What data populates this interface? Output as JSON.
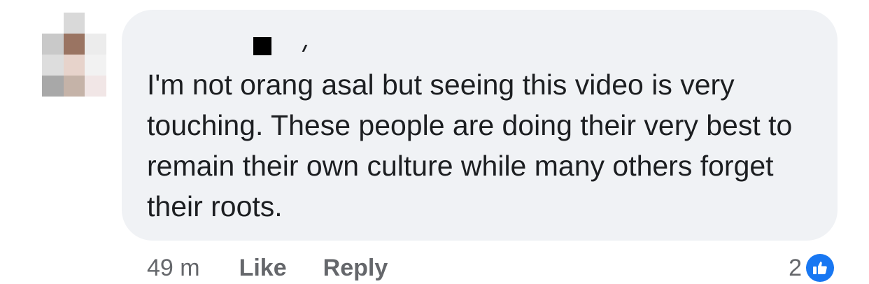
{
  "comment": {
    "text": "I'm not orang asal but seeing this video is very touching. These people are doing their very best to remain their own culture while many others forget their roots.",
    "timestamp": "49 m",
    "like_label": "Like",
    "reply_label": "Reply",
    "reaction_count": "2"
  },
  "icons": {
    "reaction": "thumbs-up-icon",
    "avatar": "profile-avatar-pixelated"
  },
  "colors": {
    "bubble_background": "#f0f2f5",
    "text_primary": "#1c1e21",
    "text_secondary": "#65676b",
    "like_blue": "#1877f2"
  }
}
